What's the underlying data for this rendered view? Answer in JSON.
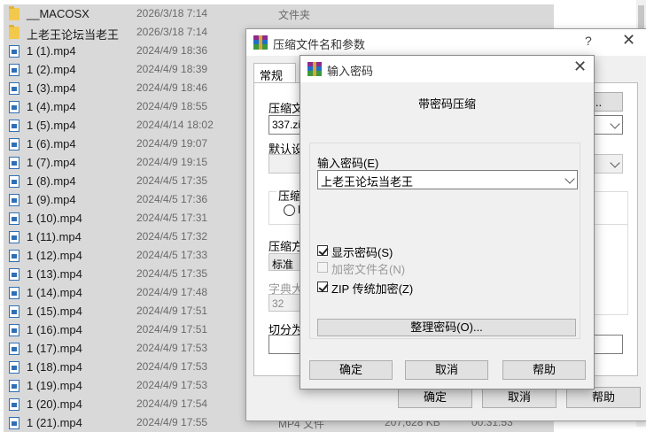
{
  "files": [
    {
      "name": "__MACOSX",
      "date": "2026/3/18 7:14",
      "type": "文件夹",
      "size": "",
      "duration": "",
      "icon": "folder-icon"
    },
    {
      "name": "上老王论坛当老王",
      "date": "2026/3/18 7:14",
      "type": "",
      "size": "",
      "duration": "",
      "icon": "folder-icon"
    },
    {
      "name": "1 (1).mp4",
      "date": "2024/4/9 18:36",
      "type": "",
      "size": "",
      "duration": "",
      "icon": "video-file-icon"
    },
    {
      "name": "1 (2).mp4",
      "date": "2024/4/9 18:39",
      "type": "",
      "size": "",
      "duration": "",
      "icon": "video-file-icon"
    },
    {
      "name": "1 (3).mp4",
      "date": "2024/4/9 18:46",
      "type": "",
      "size": "",
      "duration": "",
      "icon": "video-file-icon"
    },
    {
      "name": "1 (4).mp4",
      "date": "2024/4/9 18:55",
      "type": "",
      "size": "",
      "duration": "",
      "icon": "video-file-icon"
    },
    {
      "name": "1 (5).mp4",
      "date": "2024/4/14 18:02",
      "type": "",
      "size": "",
      "duration": "",
      "icon": "video-file-icon"
    },
    {
      "name": "1 (6).mp4",
      "date": "2024/4/9 19:07",
      "type": "",
      "size": "",
      "duration": "",
      "icon": "video-file-icon"
    },
    {
      "name": "1 (7).mp4",
      "date": "2024/4/9 19:15",
      "type": "",
      "size": "",
      "duration": "",
      "icon": "video-file-icon"
    },
    {
      "name": "1 (8).mp4",
      "date": "2024/4/5 17:35",
      "type": "",
      "size": "",
      "duration": "",
      "icon": "video-file-icon"
    },
    {
      "name": "1 (9).mp4",
      "date": "2024/4/5 17:36",
      "type": "",
      "size": "",
      "duration": "",
      "icon": "video-file-icon"
    },
    {
      "name": "1 (10).mp4",
      "date": "2024/4/5 17:31",
      "type": "",
      "size": "",
      "duration": "",
      "icon": "video-file-icon"
    },
    {
      "name": "1 (11).mp4",
      "date": "2024/4/5 17:32",
      "type": "",
      "size": "",
      "duration": "",
      "icon": "video-file-icon"
    },
    {
      "name": "1 (12).mp4",
      "date": "2024/4/5 17:33",
      "type": "",
      "size": "",
      "duration": "",
      "icon": "video-file-icon"
    },
    {
      "name": "1 (13).mp4",
      "date": "2024/4/5 17:35",
      "type": "",
      "size": "",
      "duration": "",
      "icon": "video-file-icon"
    },
    {
      "name": "1 (14).mp4",
      "date": "2024/4/9 17:48",
      "type": "",
      "size": "",
      "duration": "",
      "icon": "video-file-icon"
    },
    {
      "name": "1 (15).mp4",
      "date": "2024/4/9 17:51",
      "type": "",
      "size": "",
      "duration": "",
      "icon": "video-file-icon"
    },
    {
      "name": "1 (16).mp4",
      "date": "2024/4/9 17:51",
      "type": "",
      "size": "",
      "duration": "",
      "icon": "video-file-icon"
    },
    {
      "name": "1 (17).mp4",
      "date": "2024/4/9 17:53",
      "type": "",
      "size": "",
      "duration": "",
      "icon": "video-file-icon"
    },
    {
      "name": "1 (18).mp4",
      "date": "2024/4/9 17:53",
      "type": "",
      "size": "",
      "duration": "",
      "icon": "video-file-icon"
    },
    {
      "name": "1 (19).mp4",
      "date": "2024/4/9 17:53",
      "type": "",
      "size": "",
      "duration": "",
      "icon": "video-file-icon"
    },
    {
      "name": "1 (20).mp4",
      "date": "2024/4/9 17:54",
      "type": "",
      "size": "",
      "duration": "",
      "icon": "video-file-icon"
    },
    {
      "name": "1 (21).mp4",
      "date": "2024/4/9 17:55",
      "type": "MP4 文件",
      "size": "207,628 KB",
      "duration": "00:31:53",
      "icon": "video-file-icon"
    }
  ],
  "archive_dialog": {
    "title": "压缩文件名和参数",
    "help": "?",
    "close": "✕",
    "tab_general": "常规",
    "archive_name_label": "压缩文",
    "archive_name_value": "337.zip",
    "browse_button": "(B)...",
    "default_profile_label": "默认设",
    "format_label": "压缩文",
    "format_radio_label": "R",
    "method_label": "压缩方",
    "method_value": "标准",
    "dict_label": "字典大",
    "dict_value": "32",
    "split_label": "切分为",
    "ok": "确定",
    "cancel": "取消",
    "help_button": "帮助"
  },
  "password_dialog": {
    "title": "输入密码",
    "close": "✕",
    "heading": "带密码压缩",
    "password_label": "输入密码(E)",
    "password_value": "上老王论坛当老王",
    "show_password": "显示密码(S)",
    "encrypt_filenames": "加密文件名(N)",
    "zip_legacy": "ZIP 传统加密(Z)",
    "organize_button": "整理密码(O)...",
    "ok": "确定",
    "cancel": "取消",
    "help": "帮助"
  }
}
